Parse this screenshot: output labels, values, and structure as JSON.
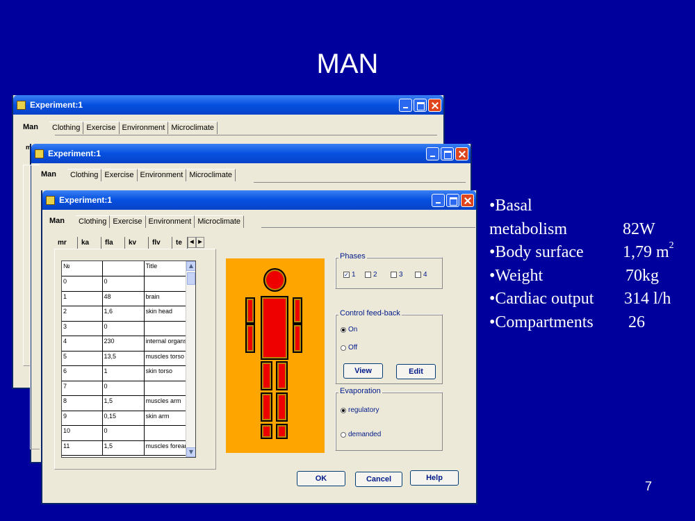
{
  "slide": {
    "title": "MAN",
    "page_number": "7",
    "bullets": [
      {
        "label": "•Basal",
        "value": ""
      },
      {
        "label": "metabolism",
        "value": "82W"
      },
      {
        "label": "•Body surface",
        "value": "1,79 m",
        "sup": "2"
      },
      {
        "label": "•Weight",
        "value": "70kg"
      },
      {
        "label": "•Cardiac output",
        "value": "314 l/h"
      },
      {
        "label": "•Compartments",
        "value": "26"
      }
    ]
  },
  "window": {
    "title": "Experiment:1",
    "tabs": [
      "Man",
      "Clothing",
      "Exercise",
      "Environment",
      "Microclimate"
    ],
    "back_partial_tab": "m"
  },
  "subtabs": [
    "mr",
    "ka",
    "fla",
    "kv",
    "flv",
    "te"
  ],
  "grid": {
    "headers": [
      "№",
      "",
      "Title"
    ],
    "rows": [
      [
        "0",
        "0",
        ""
      ],
      [
        "1",
        "48",
        "brain"
      ],
      [
        "2",
        "1,6",
        "skin head"
      ],
      [
        "3",
        "0",
        ""
      ],
      [
        "4",
        "230",
        "internal organs"
      ],
      [
        "5",
        "13,5",
        "muscles torso"
      ],
      [
        "6",
        "1",
        "skin torso"
      ],
      [
        "7",
        "0",
        ""
      ],
      [
        "8",
        "1,5",
        "muscles arm"
      ],
      [
        "9",
        "0,15",
        "skin arm"
      ],
      [
        "10",
        "0",
        ""
      ],
      [
        "11",
        "1,5",
        "muscles forearm"
      ]
    ]
  },
  "phases": {
    "title": "Phases",
    "options": [
      {
        "label": "1",
        "checked": true
      },
      {
        "label": "2",
        "checked": false
      },
      {
        "label": "3",
        "checked": false
      },
      {
        "label": "4",
        "checked": false
      }
    ]
  },
  "control_feedback": {
    "title": "Control feed-back",
    "on_label": "On",
    "off_label": "Off",
    "selected": "On",
    "view_label": "View",
    "edit_label": "Edit"
  },
  "evaporation": {
    "title": "Evaporation",
    "regulatory_label": "regulatory",
    "demanded_label": "demanded",
    "selected": "regulatory"
  },
  "dialog_buttons": {
    "ok": "OK",
    "cancel": "Cancel",
    "help": "Help"
  },
  "colors": {
    "slide_bg": "#00009c",
    "figure_bg": "#ffa500",
    "body_part": "#ee0000"
  }
}
